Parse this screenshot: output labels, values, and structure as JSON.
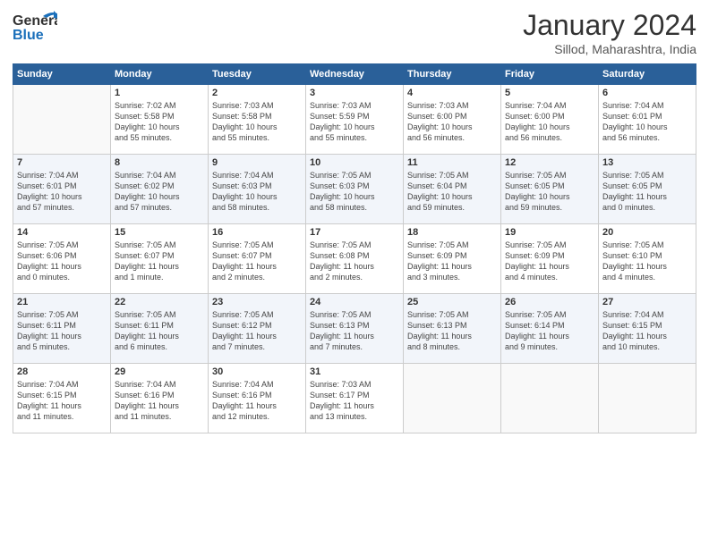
{
  "header": {
    "logo_line1": "General",
    "logo_line2": "Blue",
    "month": "January 2024",
    "location": "Sillod, Maharashtra, India"
  },
  "columns": [
    "Sunday",
    "Monday",
    "Tuesday",
    "Wednesday",
    "Thursday",
    "Friday",
    "Saturday"
  ],
  "weeks": [
    [
      {
        "day": "",
        "info": ""
      },
      {
        "day": "1",
        "info": "Sunrise: 7:02 AM\nSunset: 5:58 PM\nDaylight: 10 hours\nand 55 minutes."
      },
      {
        "day": "2",
        "info": "Sunrise: 7:03 AM\nSunset: 5:58 PM\nDaylight: 10 hours\nand 55 minutes."
      },
      {
        "day": "3",
        "info": "Sunrise: 7:03 AM\nSunset: 5:59 PM\nDaylight: 10 hours\nand 55 minutes."
      },
      {
        "day": "4",
        "info": "Sunrise: 7:03 AM\nSunset: 6:00 PM\nDaylight: 10 hours\nand 56 minutes."
      },
      {
        "day": "5",
        "info": "Sunrise: 7:04 AM\nSunset: 6:00 PM\nDaylight: 10 hours\nand 56 minutes."
      },
      {
        "day": "6",
        "info": "Sunrise: 7:04 AM\nSunset: 6:01 PM\nDaylight: 10 hours\nand 56 minutes."
      }
    ],
    [
      {
        "day": "7",
        "info": "Sunrise: 7:04 AM\nSunset: 6:01 PM\nDaylight: 10 hours\nand 57 minutes."
      },
      {
        "day": "8",
        "info": "Sunrise: 7:04 AM\nSunset: 6:02 PM\nDaylight: 10 hours\nand 57 minutes."
      },
      {
        "day": "9",
        "info": "Sunrise: 7:04 AM\nSunset: 6:03 PM\nDaylight: 10 hours\nand 58 minutes."
      },
      {
        "day": "10",
        "info": "Sunrise: 7:05 AM\nSunset: 6:03 PM\nDaylight: 10 hours\nand 58 minutes."
      },
      {
        "day": "11",
        "info": "Sunrise: 7:05 AM\nSunset: 6:04 PM\nDaylight: 10 hours\nand 59 minutes."
      },
      {
        "day": "12",
        "info": "Sunrise: 7:05 AM\nSunset: 6:05 PM\nDaylight: 10 hours\nand 59 minutes."
      },
      {
        "day": "13",
        "info": "Sunrise: 7:05 AM\nSunset: 6:05 PM\nDaylight: 11 hours\nand 0 minutes."
      }
    ],
    [
      {
        "day": "14",
        "info": "Sunrise: 7:05 AM\nSunset: 6:06 PM\nDaylight: 11 hours\nand 0 minutes."
      },
      {
        "day": "15",
        "info": "Sunrise: 7:05 AM\nSunset: 6:07 PM\nDaylight: 11 hours\nand 1 minute."
      },
      {
        "day": "16",
        "info": "Sunrise: 7:05 AM\nSunset: 6:07 PM\nDaylight: 11 hours\nand 2 minutes."
      },
      {
        "day": "17",
        "info": "Sunrise: 7:05 AM\nSunset: 6:08 PM\nDaylight: 11 hours\nand 2 minutes."
      },
      {
        "day": "18",
        "info": "Sunrise: 7:05 AM\nSunset: 6:09 PM\nDaylight: 11 hours\nand 3 minutes."
      },
      {
        "day": "19",
        "info": "Sunrise: 7:05 AM\nSunset: 6:09 PM\nDaylight: 11 hours\nand 4 minutes."
      },
      {
        "day": "20",
        "info": "Sunrise: 7:05 AM\nSunset: 6:10 PM\nDaylight: 11 hours\nand 4 minutes."
      }
    ],
    [
      {
        "day": "21",
        "info": "Sunrise: 7:05 AM\nSunset: 6:11 PM\nDaylight: 11 hours\nand 5 minutes."
      },
      {
        "day": "22",
        "info": "Sunrise: 7:05 AM\nSunset: 6:11 PM\nDaylight: 11 hours\nand 6 minutes."
      },
      {
        "day": "23",
        "info": "Sunrise: 7:05 AM\nSunset: 6:12 PM\nDaylight: 11 hours\nand 7 minutes."
      },
      {
        "day": "24",
        "info": "Sunrise: 7:05 AM\nSunset: 6:13 PM\nDaylight: 11 hours\nand 7 minutes."
      },
      {
        "day": "25",
        "info": "Sunrise: 7:05 AM\nSunset: 6:13 PM\nDaylight: 11 hours\nand 8 minutes."
      },
      {
        "day": "26",
        "info": "Sunrise: 7:05 AM\nSunset: 6:14 PM\nDaylight: 11 hours\nand 9 minutes."
      },
      {
        "day": "27",
        "info": "Sunrise: 7:04 AM\nSunset: 6:15 PM\nDaylight: 11 hours\nand 10 minutes."
      }
    ],
    [
      {
        "day": "28",
        "info": "Sunrise: 7:04 AM\nSunset: 6:15 PM\nDaylight: 11 hours\nand 11 minutes."
      },
      {
        "day": "29",
        "info": "Sunrise: 7:04 AM\nSunset: 6:16 PM\nDaylight: 11 hours\nand 11 minutes."
      },
      {
        "day": "30",
        "info": "Sunrise: 7:04 AM\nSunset: 6:16 PM\nDaylight: 11 hours\nand 12 minutes."
      },
      {
        "day": "31",
        "info": "Sunrise: 7:03 AM\nSunset: 6:17 PM\nDaylight: 11 hours\nand 13 minutes."
      },
      {
        "day": "",
        "info": ""
      },
      {
        "day": "",
        "info": ""
      },
      {
        "day": "",
        "info": ""
      }
    ]
  ]
}
